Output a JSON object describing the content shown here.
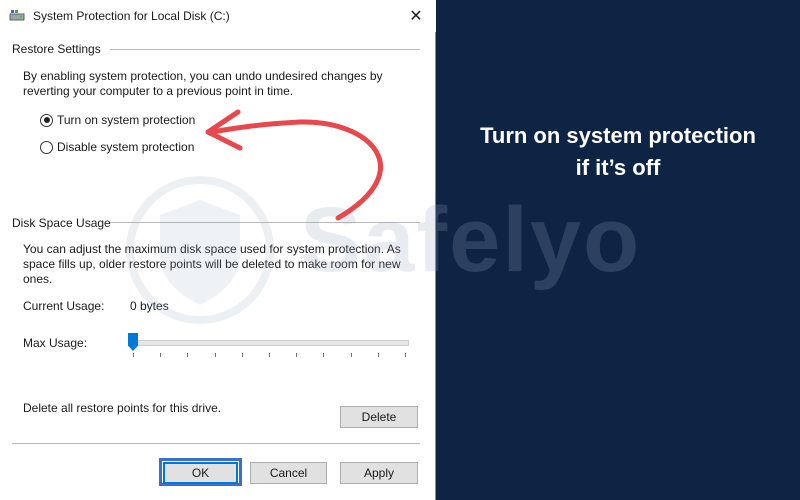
{
  "window": {
    "title": "System Protection for Local Disk (C:)",
    "close_glyph": "✕"
  },
  "restore_settings": {
    "heading": "Restore Settings",
    "description_line1": "By enabling system protection, you can undo undesired changes by",
    "description_line2": "reverting your computer to a previous point in time.",
    "options": [
      {
        "label": "Turn on system protection",
        "checked": true
      },
      {
        "label": "Disable system protection",
        "checked": false
      }
    ]
  },
  "disk_space": {
    "heading": "Disk Space Usage",
    "description_line1": "You can adjust the maximum disk space used for system protection. As",
    "description_line2": "space fills up, older restore points will be deleted to make room for new",
    "description_line3": "ones.",
    "current_usage_label": "Current Usage:",
    "current_usage_value": "0 bytes",
    "max_usage_label": "Max Usage:",
    "max_usage_fraction": 0.0
  },
  "delete_section": {
    "text": "Delete all restore points for this drive.",
    "delete_button": "Delete"
  },
  "footer_buttons": {
    "ok": "OK",
    "cancel": "Cancel",
    "apply": "Apply"
  },
  "overlay": {
    "caption_line1": "Turn on system protection",
    "caption_line2": "if it’s off",
    "watermark": "Safelyo",
    "background_color": "#0d2444",
    "arrow_color": "#e8474b"
  }
}
